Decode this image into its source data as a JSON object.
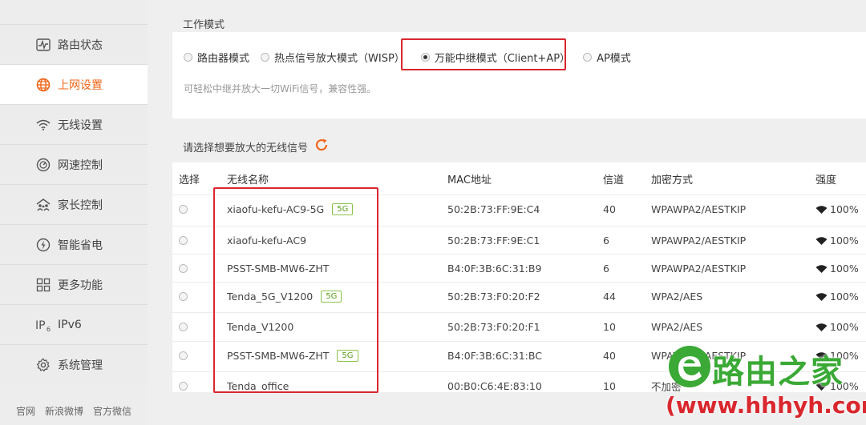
{
  "sidebar": {
    "items": [
      {
        "label": "路由状态",
        "icon": "pulse-icon"
      },
      {
        "label": "上网设置",
        "icon": "globe-icon",
        "active": true
      },
      {
        "label": "无线设置",
        "icon": "wifi-icon"
      },
      {
        "label": "网速控制",
        "icon": "speedometer-icon"
      },
      {
        "label": "家长控制",
        "icon": "family-icon"
      },
      {
        "label": "智能省电",
        "icon": "power-icon"
      },
      {
        "label": "更多功能",
        "icon": "grid-icon"
      },
      {
        "label": "IPv6",
        "icon": "ipv6-icon"
      },
      {
        "label": "系统管理",
        "icon": "gear-icon"
      }
    ],
    "footer": [
      "官网",
      "新浪微博",
      "官方微信"
    ]
  },
  "mode": {
    "title": "工作模式",
    "options": [
      "路由器模式",
      "热点信号放大模式（WISP）",
      "万能中继模式（Client+AP）",
      "AP模式"
    ],
    "selected_index": 2,
    "description": "可轻松中继并放大一切WiFi信号，兼容性强。"
  },
  "signals": {
    "title": "请选择想要放大的无线信号",
    "headers": {
      "select": "选择",
      "name": "无线名称",
      "mac": "MAC地址",
      "channel": "信道",
      "encryption": "加密方式",
      "strength": "强度"
    },
    "rows": [
      {
        "name": "xiaofu-kefu-AC9-5G",
        "badge": "5G",
        "mac": "50:2B:73:FF:9E:C4",
        "channel": "40",
        "encryption": "WPAWPA2/AESTKIP",
        "strength": "100%"
      },
      {
        "name": "xiaofu-kefu-AC9",
        "badge": "",
        "mac": "50:2B:73:FF:9E:C1",
        "channel": "6",
        "encryption": "WPAWPA2/AESTKIP",
        "strength": "100%"
      },
      {
        "name": "PSST-SMB-MW6-ZHT",
        "badge": "",
        "mac": "B4:0F:3B:6C:31:B9",
        "channel": "6",
        "encryption": "WPAWPA2/AESTKIP",
        "strength": "100%"
      },
      {
        "name": "Tenda_5G_V1200",
        "badge": "5G",
        "mac": "50:2B:73:F0:20:F2",
        "channel": "44",
        "encryption": "WPA2/AES",
        "strength": "100%"
      },
      {
        "name": "Tenda_V1200",
        "badge": "",
        "mac": "50:2B:73:F0:20:F1",
        "channel": "10",
        "encryption": "WPA2/AES",
        "strength": "100%"
      },
      {
        "name": "PSST-SMB-MW6-ZHT",
        "badge": "5G",
        "mac": "B4:0F:3B:6C:31:BC",
        "channel": "40",
        "encryption": "WPAWPA2/AESTKIP",
        "strength": "100%"
      },
      {
        "name": "Tenda_office",
        "badge": "",
        "mac": "00:B0:C6:4E:83:10",
        "channel": "10",
        "encryption": "不加密",
        "strength": "100%"
      }
    ]
  },
  "watermark": {
    "logo_text": "路由之家",
    "url": "(www.hhhyh.com)"
  },
  "colors": {
    "accent": "#f0661a",
    "highlight": "#d9272e",
    "badge": "#5a9e1c",
    "brand": "#3aa935"
  }
}
